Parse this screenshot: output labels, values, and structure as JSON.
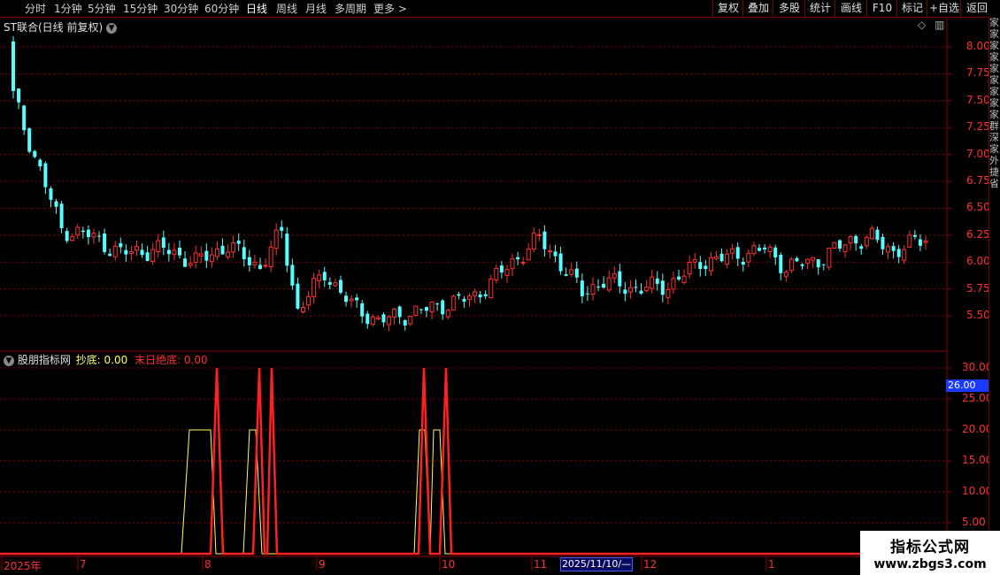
{
  "toolbar": {
    "periods": [
      "分时",
      "1分钟",
      "5分钟",
      "15分钟",
      "30分钟",
      "60分钟",
      "日线",
      "周线",
      "月线",
      "多周期",
      "更多 >"
    ],
    "active_period": "日线",
    "right_buttons": [
      "复权",
      "叠加",
      "多股",
      "统计",
      "画线",
      "F10",
      "标记",
      "+自选",
      "返回"
    ]
  },
  "main_chart": {
    "title": "ST联合(日线 前复权)",
    "y_ticks": [
      "8.00",
      "7.75",
      "7.50",
      "7.25",
      "7.00",
      "6.75",
      "6.50",
      "6.25",
      "6.00",
      "5.75",
      "5.50"
    ]
  },
  "indicator": {
    "name": "股朋指标网",
    "line1_label": "抄底: 0.00",
    "line2_label": "末日绝底: 0.00",
    "y_ticks": [
      "30.00",
      "25.00",
      "20.00",
      "15.00",
      "10.00",
      "5.00"
    ],
    "current_value": "26.00"
  },
  "x_axis": {
    "labels": [
      "2025年",
      "7",
      "8",
      "9",
      "10",
      "11",
      "12",
      "1"
    ],
    "cursor_date": "2025/11/10/—"
  },
  "right_panel_text": "家家家家家家家家家群深家外捷省",
  "watermark": {
    "title": "指标公式网",
    "url": "www.zbgs3.com"
  },
  "colors": {
    "up": "#ff3232",
    "down": "#54ffff",
    "grid": "#8a0000",
    "yellow": "#ffff54",
    "red_line": "#ff2020"
  }
}
